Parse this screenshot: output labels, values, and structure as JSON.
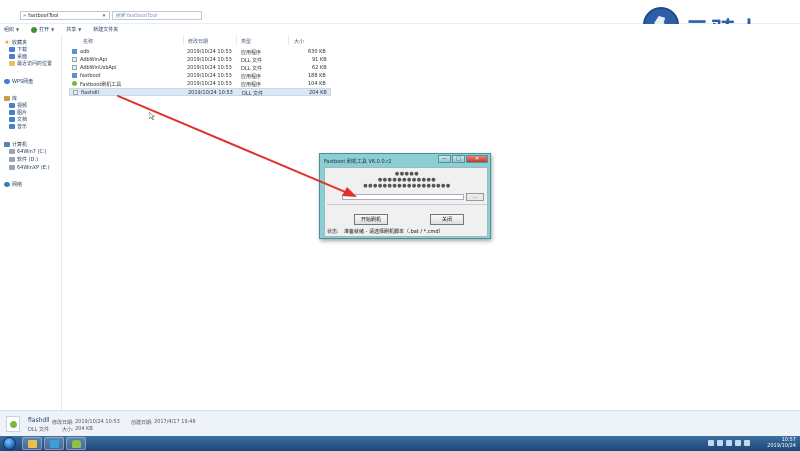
{
  "address": {
    "path": "fastbootTool",
    "search_placeholder": "搜索 fastbootTool"
  },
  "toolbar": {
    "organize": "组织",
    "open": "打开",
    "share": "共享",
    "new_folder": "新建文件夹"
  },
  "nav": {
    "favorites": "收藏夹",
    "downloads": "下载",
    "desktop": "桌面",
    "recent": "最近访问的位置",
    "wps": "WPS网盘",
    "libraries": "库",
    "videos": "视频",
    "pictures": "图片",
    "documents": "文档",
    "music": "音乐",
    "computer": "计算机",
    "drive_c": "64Win7 (C:)",
    "drive_d": "软件 (D:)",
    "drive_e": "64WinXP (E:)",
    "network": "网络"
  },
  "columns": {
    "name": "名称",
    "modified": "修改日期",
    "type": "类型",
    "size": "大小"
  },
  "files": [
    {
      "name": "adb",
      "modified": "2019/10/24 10:53",
      "type": "应用程序",
      "size": "630 KB",
      "icon": "exe-icon"
    },
    {
      "name": "AdbWinApi",
      "modified": "2019/10/24 10:53",
      "type": "DLL 文件",
      "size": "91 KB",
      "icon": "dll-icon"
    },
    {
      "name": "AdbWinUsbApi",
      "modified": "2019/10/24 10:53",
      "type": "DLL 文件",
      "size": "62 KB",
      "icon": "dll-icon"
    },
    {
      "name": "fastboot",
      "modified": "2019/10/24 10:53",
      "type": "应用程序",
      "size": "188 KB",
      "icon": "exe-icon"
    },
    {
      "name": "Fastboot刷机工具",
      "modified": "2019/10/24 10:53",
      "type": "应用程序",
      "size": "104 KB",
      "icon": "green-icon"
    },
    {
      "name": "flashdll",
      "modified": "2019/10/24 10:53",
      "type": "DLL 文件",
      "size": "204 KB",
      "icon": "dll-icon"
    }
  ],
  "status": {
    "name": "flashdll",
    "modified_label": "修改日期:",
    "modified": "2019/10/24 10:53",
    "created_label": "创建日期:",
    "created": "2017/4/17 19:46",
    "type": "DLL 文件",
    "size_label": "大小:",
    "size": "204 KB"
  },
  "logo": {
    "text": "云骑士"
  },
  "dialog": {
    "title": "Fastboot 刷机工具 V6.0.0.r2",
    "minimize": "—",
    "maximize": "□",
    "close": "✕",
    "line1": "●●●●●",
    "line2": "●●●●●●●●●●●●",
    "line3": "●●●●●●●●●●●●●●●●●●",
    "browse": "...",
    "start": "开始刷机",
    "close_btn": "关闭",
    "status_label": "状态:",
    "status_text": "准备就绪 - 请选择刷机脚本（.bat / *.cmd）"
  },
  "clock": {
    "time": "10:57",
    "date": "2019/10/24"
  },
  "colors": {
    "accent": "#2c5fa8",
    "arrow": "#e0312b",
    "dialog": "#8ccfd3"
  }
}
